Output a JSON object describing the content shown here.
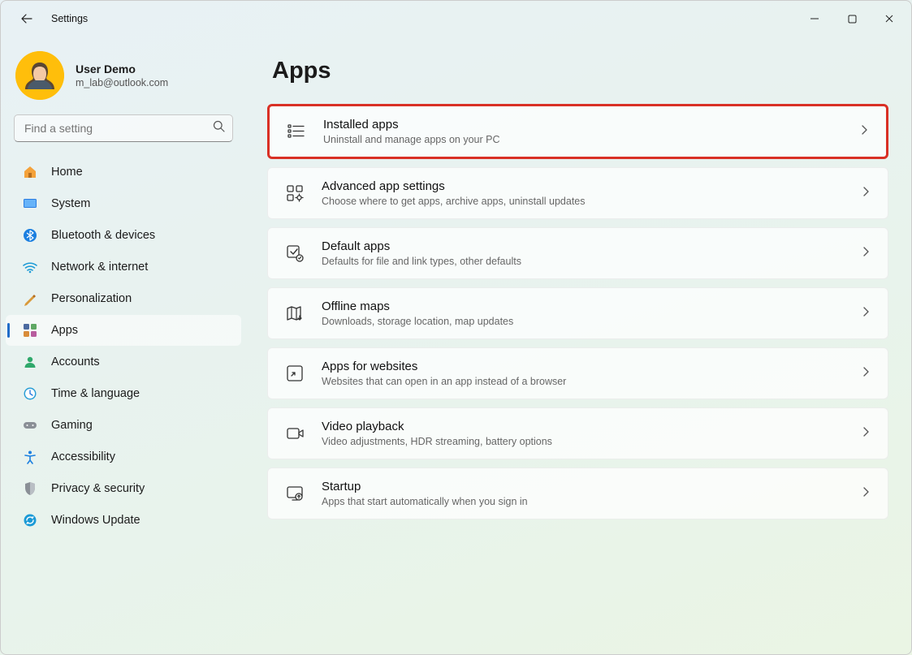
{
  "window": {
    "title": "Settings"
  },
  "user": {
    "name": "User Demo",
    "email": "m_lab@outlook.com"
  },
  "search": {
    "placeholder": "Find a setting"
  },
  "sidebar": {
    "items": [
      {
        "id": "home",
        "label": "Home"
      },
      {
        "id": "system",
        "label": "System"
      },
      {
        "id": "bluetooth",
        "label": "Bluetooth & devices"
      },
      {
        "id": "network",
        "label": "Network & internet"
      },
      {
        "id": "personalization",
        "label": "Personalization"
      },
      {
        "id": "apps",
        "label": "Apps",
        "active": true
      },
      {
        "id": "accounts",
        "label": "Accounts"
      },
      {
        "id": "time",
        "label": "Time & language"
      },
      {
        "id": "gaming",
        "label": "Gaming"
      },
      {
        "id": "accessibility",
        "label": "Accessibility"
      },
      {
        "id": "privacy",
        "label": "Privacy & security"
      },
      {
        "id": "update",
        "label": "Windows Update"
      }
    ]
  },
  "page": {
    "title": "Apps",
    "highlight_index": 0,
    "cards": [
      {
        "title": "Installed apps",
        "sub": "Uninstall and manage apps on your PC"
      },
      {
        "title": "Advanced app settings",
        "sub": "Choose where to get apps, archive apps, uninstall updates"
      },
      {
        "title": "Default apps",
        "sub": "Defaults for file and link types, other defaults"
      },
      {
        "title": "Offline maps",
        "sub": "Downloads, storage location, map updates"
      },
      {
        "title": "Apps for websites",
        "sub": "Websites that can open in an app instead of a browser"
      },
      {
        "title": "Video playback",
        "sub": "Video adjustments, HDR streaming, battery options"
      },
      {
        "title": "Startup",
        "sub": "Apps that start automatically when you sign in"
      }
    ]
  }
}
